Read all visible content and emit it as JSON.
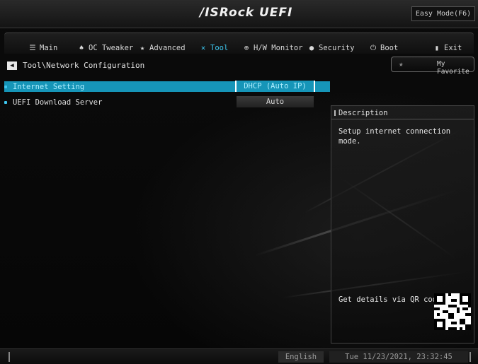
{
  "header": {
    "logo_text": "/ISRock UEFI",
    "easy_mode_label": "Easy Mode(F6)"
  },
  "tabs": [
    {
      "label": "Main",
      "icon": "list-icon",
      "glyph": "☰"
    },
    {
      "label": "OC Tweaker",
      "icon": "rocket-icon",
      "glyph": "♠"
    },
    {
      "label": "Advanced",
      "icon": "star-icon",
      "glyph": "★"
    },
    {
      "label": "Tool",
      "icon": "tools-icon",
      "glyph": "✕",
      "active": true
    },
    {
      "label": "H/W Monitor",
      "icon": "monitor-icon",
      "glyph": "⊕"
    },
    {
      "label": "Security",
      "icon": "shield-icon",
      "glyph": "●"
    },
    {
      "label": "Boot",
      "icon": "power-icon",
      "glyph": "⏻"
    },
    {
      "label": "Exit",
      "icon": "exit-icon",
      "glyph": "▮"
    }
  ],
  "breadcrumb": {
    "path": "Tool\\Network Configuration",
    "back_glyph": "◀"
  },
  "favorite": {
    "label": "My Favorite",
    "star_glyph": "★"
  },
  "settings": [
    {
      "name": "Internet Setting",
      "value": "DHCP (Auto IP)",
      "selected": true
    },
    {
      "name": "UEFI Download Server",
      "value": "Auto",
      "selected": false
    }
  ],
  "description": {
    "title": "Description",
    "text": "Setup internet connection mode.",
    "qr_label": "Get details via QR code"
  },
  "footer": {
    "language": "English",
    "datetime": "Tue 11/23/2021, 23:32:45"
  },
  "colors": {
    "accent": "#1695b8",
    "active_tab": "#3ec8f0"
  }
}
